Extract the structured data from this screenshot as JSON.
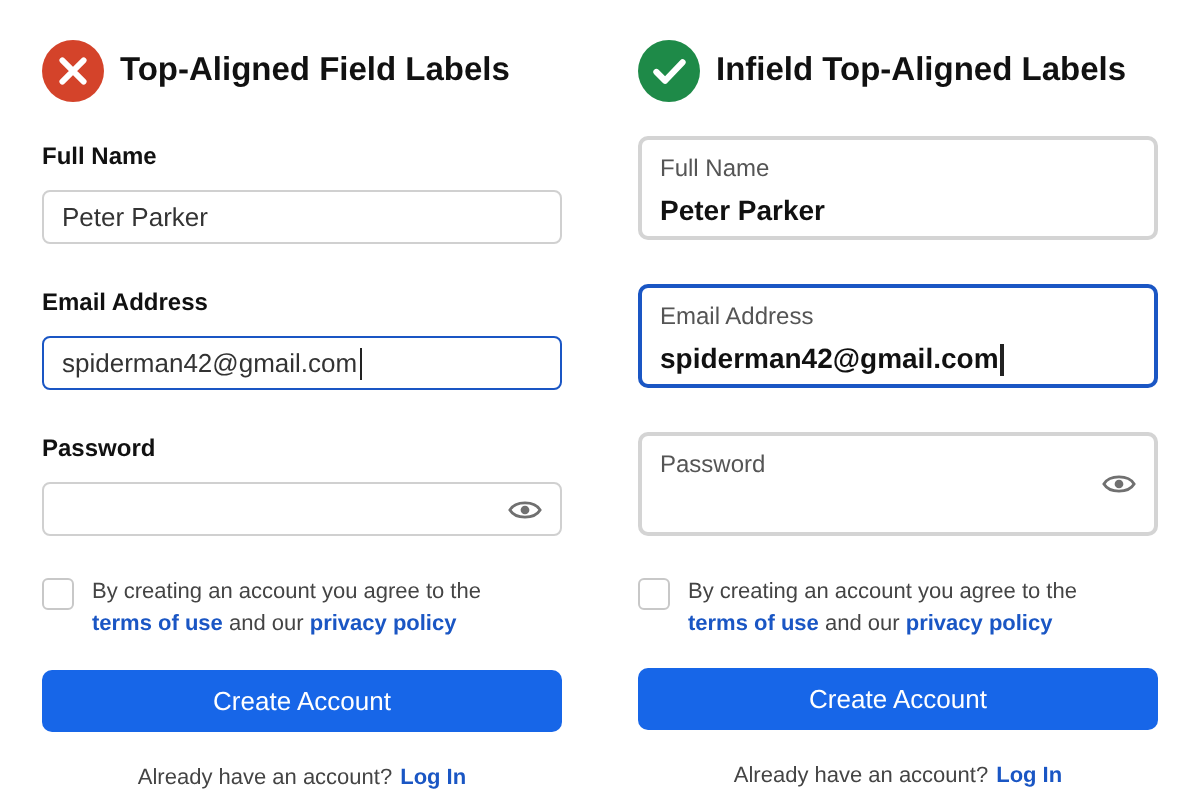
{
  "panels": [
    {
      "badge": {
        "kind": "cross"
      },
      "title": "Top-Aligned Field Labels",
      "kind": "top",
      "fields": [
        {
          "label": "Full Name",
          "value": "Peter Parker",
          "focused": false,
          "kind": "text"
        },
        {
          "label": "Email Address",
          "value": "spiderman42@gmail.com",
          "focused": true,
          "kind": "text"
        },
        {
          "label": "Password",
          "focused": false,
          "kind": "password"
        }
      ],
      "consent": {
        "checked": false,
        "text_before": "By creating an account you agree to the",
        "terms_link": "terms of use",
        "middle": "and our",
        "privacy_link": "privacy policy"
      },
      "button": "Create Account",
      "login": {
        "prompt": "Already have an account?",
        "link": "Log In"
      }
    },
    {
      "badge": {
        "kind": "check"
      },
      "title": "Infield Top-Aligned Labels",
      "kind": "infield",
      "fields": [
        {
          "label": "Full Name",
          "value": "Peter Parker",
          "focused": false,
          "kind": "text"
        },
        {
          "label": "Email Address",
          "value": "spiderman42@gmail.com",
          "focused": true,
          "kind": "text"
        },
        {
          "label": "Password",
          "focused": false,
          "kind": "password"
        }
      ],
      "consent": {
        "checked": false,
        "text_before": "By creating an account you agree to the",
        "terms_link": "terms of use",
        "middle": "and our",
        "privacy_link": "privacy policy"
      },
      "button": "Create Account",
      "login": {
        "prompt": "Already have an account?",
        "link": "Log In"
      }
    }
  ]
}
